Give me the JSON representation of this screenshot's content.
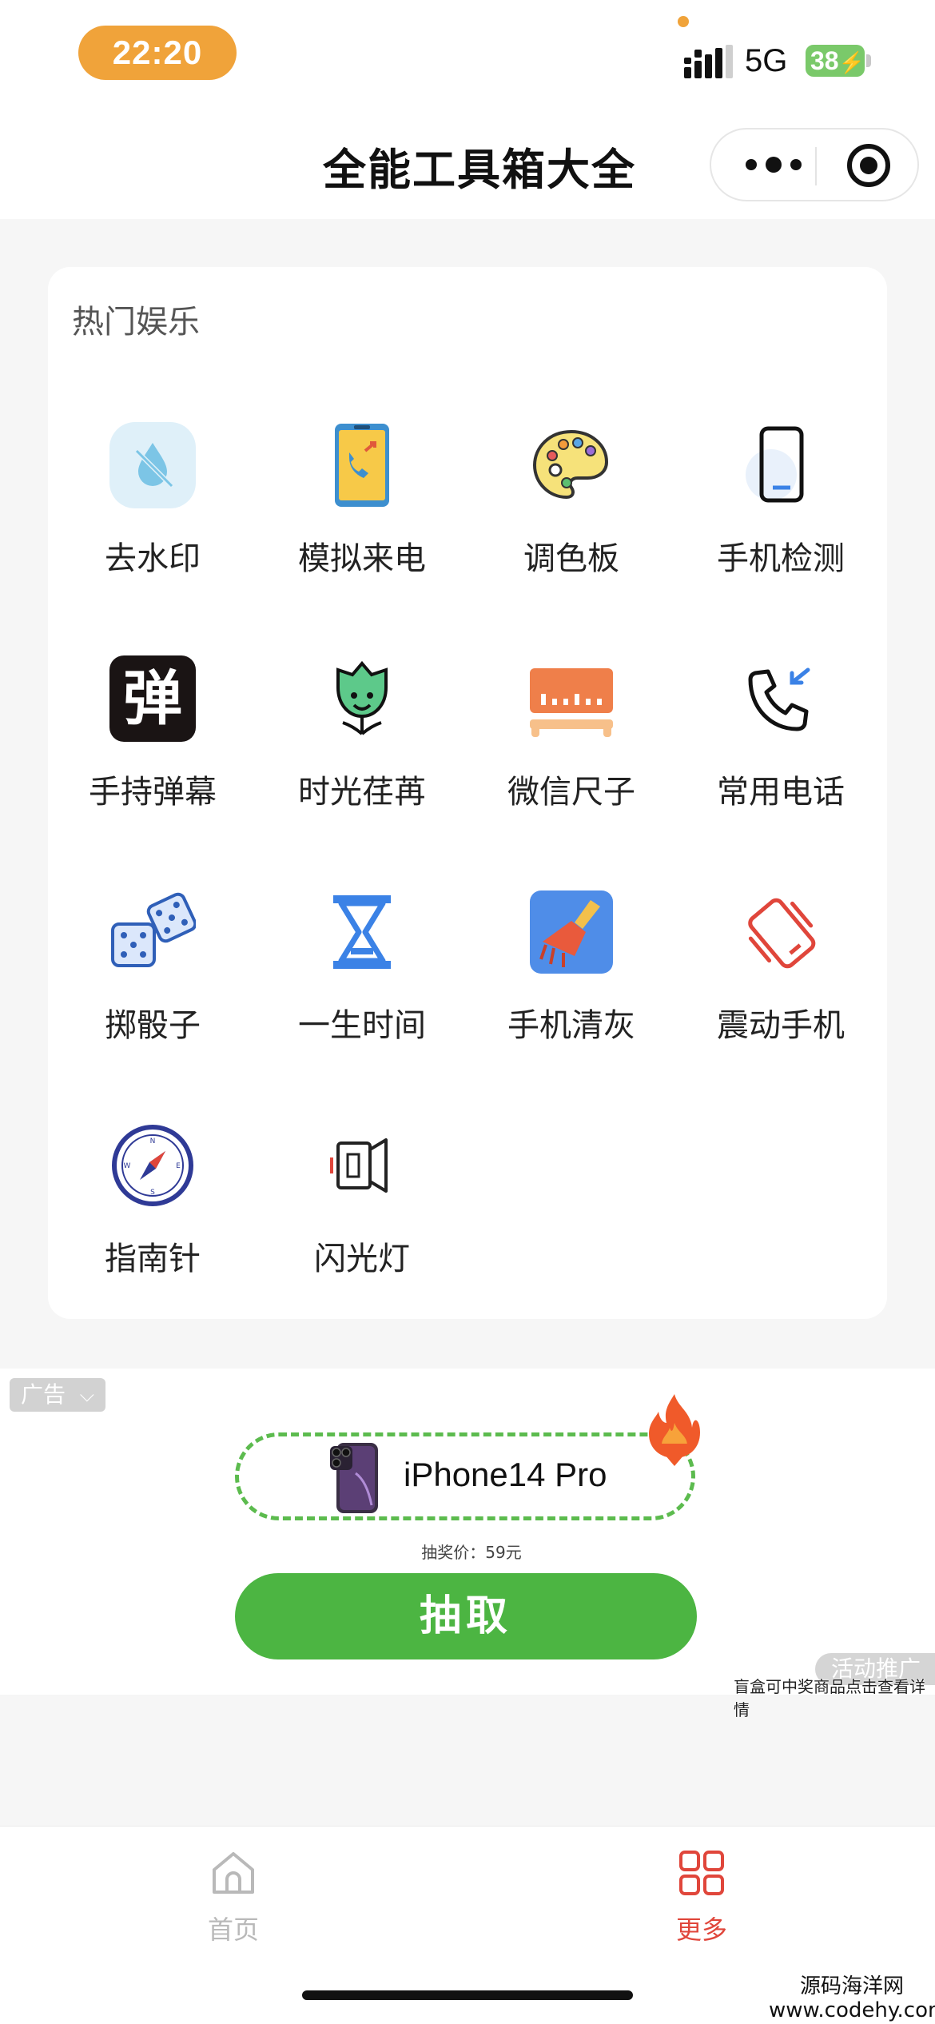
{
  "status_bar": {
    "time": "22:20",
    "network": "5G",
    "battery": "38"
  },
  "nav": {
    "title": "全能工具箱大全"
  },
  "section": {
    "title": "热门娱乐"
  },
  "tools": [
    {
      "label": "去水印",
      "icon": "droplet-crossed-icon"
    },
    {
      "label": "模拟来电",
      "icon": "incoming-call-phone-icon"
    },
    {
      "label": "调色板",
      "icon": "palette-icon"
    },
    {
      "label": "手机检测",
      "icon": "phone-check-icon"
    },
    {
      "label": "手持弹幕",
      "icon": "danmaku-icon"
    },
    {
      "label": "时光荏苒",
      "icon": "lotus-face-icon"
    },
    {
      "label": "微信尺子",
      "icon": "ruler-icon"
    },
    {
      "label": "常用电话",
      "icon": "phone-callback-icon"
    },
    {
      "label": "掷骰子",
      "icon": "dice-icon"
    },
    {
      "label": "一生时间",
      "icon": "hourglass-icon"
    },
    {
      "label": "手机清灰",
      "icon": "broom-icon"
    },
    {
      "label": "震动手机",
      "icon": "vibrate-phone-icon"
    },
    {
      "label": "指南针",
      "icon": "compass-icon"
    },
    {
      "label": "闪光灯",
      "icon": "flashlight-icon"
    }
  ],
  "danmaku_char": "弹",
  "ad": {
    "tag": "广告",
    "prize_name": "iPhone14 Pro",
    "price_line": "抽奖价：59元",
    "button": "抽取",
    "promo_chip": "活动推广",
    "promo_text": "盲盒可中奖商品点击查看详情"
  },
  "tabbar": {
    "home_label": "首页",
    "more_label": "更多",
    "active_color": "#e0463b",
    "inactive_color": "#b9b9b9"
  },
  "watermark": [
    "源码海洋网",
    "www.codehy.com"
  ]
}
